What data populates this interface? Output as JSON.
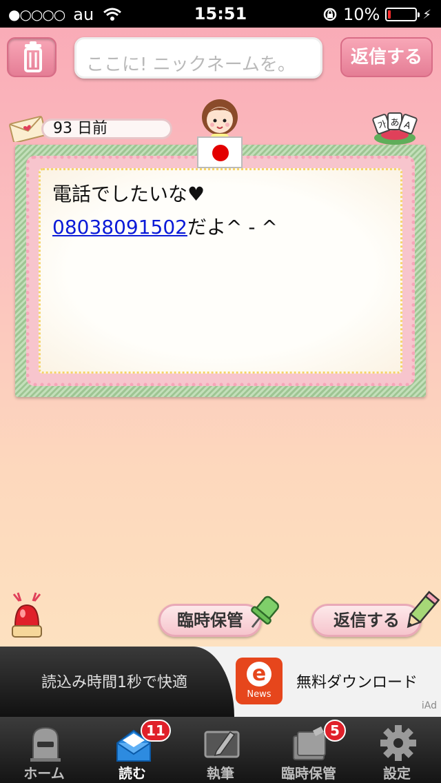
{
  "status_bar": {
    "signal_dots": "●○○○○",
    "carrier": "au",
    "time": "15:51",
    "battery_percent": "10%",
    "battery_level": 0.1
  },
  "top_bar": {
    "trash_icon": "trash-icon",
    "nickname_placeholder": "ここに! ニックネームを。",
    "reply_label": "返信する"
  },
  "letter": {
    "date": "93 日前",
    "message_line1": "電話でしたいな♥",
    "phone_number": "08038091502",
    "message_line2_suffix": "だよ^ - ^",
    "flag": "japan-flag"
  },
  "actions": {
    "temp_save_label": "臨時保管",
    "reply_label": "返信する"
  },
  "ad": {
    "left_text": "読込み時間1秒で快適",
    "logo_letter": "e",
    "logo_text": "News",
    "right_text": "無料ダウンロード",
    "tag": "iAd"
  },
  "tabs": [
    {
      "label": "ホーム",
      "icon": "mailbox-icon"
    },
    {
      "label": "読む",
      "icon": "open-mail-icon",
      "badge": "11",
      "active": true
    },
    {
      "label": "執筆",
      "icon": "write-icon"
    },
    {
      "label": "臨時保管",
      "icon": "folder-icon",
      "badge": "5"
    },
    {
      "label": "設定",
      "icon": "gear-icon"
    }
  ],
  "colors": {
    "accent_pink": "#e57d95",
    "link": "#0a1ad8",
    "badge": "#e0202a"
  }
}
